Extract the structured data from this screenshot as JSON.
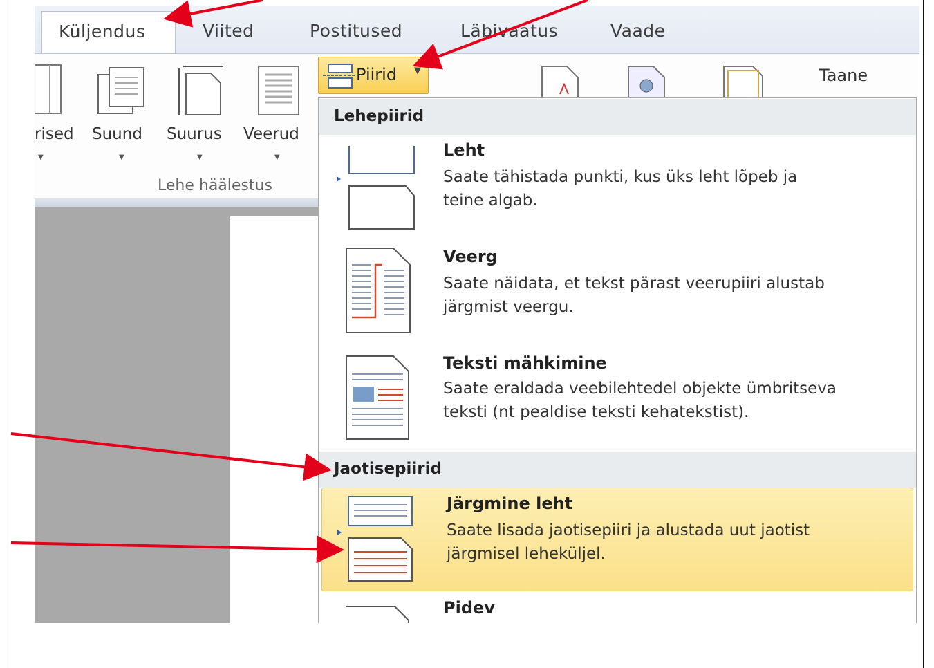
{
  "ribbon": {
    "tabs": [
      "Küljendus",
      "Viited",
      "Postitused",
      "Läbivaatus",
      "Vaade"
    ],
    "buttons": [
      "rised",
      "Suund",
      "Suurus",
      "Veerud"
    ],
    "group_label": "Lehe häälestus",
    "piirid_label": "Piirid",
    "right_label": "Taane"
  },
  "menu": {
    "section1": "Lehepiirid",
    "section2": "Jaotisepiirid",
    "items": [
      {
        "title": "Leht",
        "desc1": "Saate tähistada punkti, kus üks leht lõpeb ja",
        "desc2": "teine algab."
      },
      {
        "title": "Veerg",
        "desc1": "Saate näidata, et tekst pärast veerupiiri alustab",
        "desc2": "järgmist veergu."
      },
      {
        "title": "Teksti mähkimine",
        "desc1": "Saate eraldada veebilehtedel objekte ümbritseva",
        "desc2": "teksti (nt pealdise teksti kehatekstist)."
      },
      {
        "title": "Järgmine leht",
        "desc1": "Saate lisada jaotisepiiri ja alustada uut jaotist",
        "desc2": "järgmisel leheküljel."
      },
      {
        "title": "Pidev"
      }
    ]
  },
  "colors": {
    "arrow": "#e3001b",
    "highlight": "#fbe08a"
  }
}
